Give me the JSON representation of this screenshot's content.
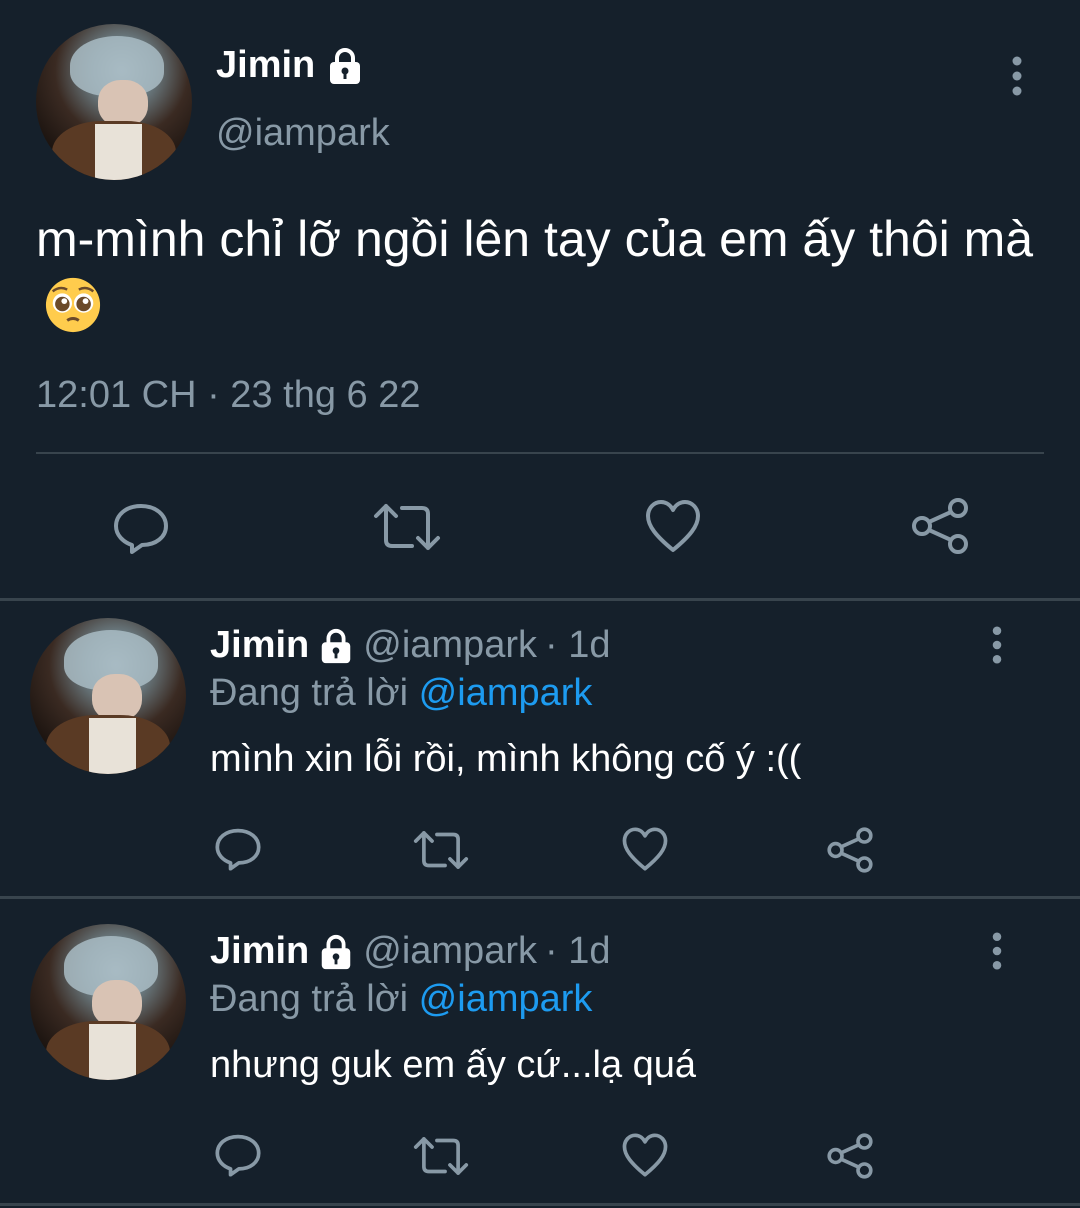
{
  "main_tweet": {
    "name": "Jimin",
    "handle": "@iampark",
    "text": "m-mình chỉ lỡ ngồi lên tay của em ấy thôi mà",
    "emoji": "pleading-face-emoji",
    "timestamp": "12:01 CH · 23 thg 6 22"
  },
  "replies": [
    {
      "name": "Jimin",
      "handle": "@iampark",
      "time": "· 1d",
      "replying_label": "Đang trả lời",
      "replying_to": "@iampark",
      "text": "mình xin lỗi rồi, mình không cố ý :(("
    },
    {
      "name": "Jimin",
      "handle": "@iampark",
      "time": "· 1d",
      "replying_label": "Đang trả lời",
      "replying_to": "@iampark",
      "text": "nhưng guk em ấy cứ...lạ quá"
    }
  ],
  "icons": [
    "lock-icon",
    "more-vertical-icon",
    "reply-icon",
    "retweet-icon",
    "like-icon",
    "share-icon"
  ],
  "colors": {
    "background": "#15202b",
    "muted": "#8899a6",
    "accent": "#1d9bf0",
    "divider": "#38444d"
  }
}
